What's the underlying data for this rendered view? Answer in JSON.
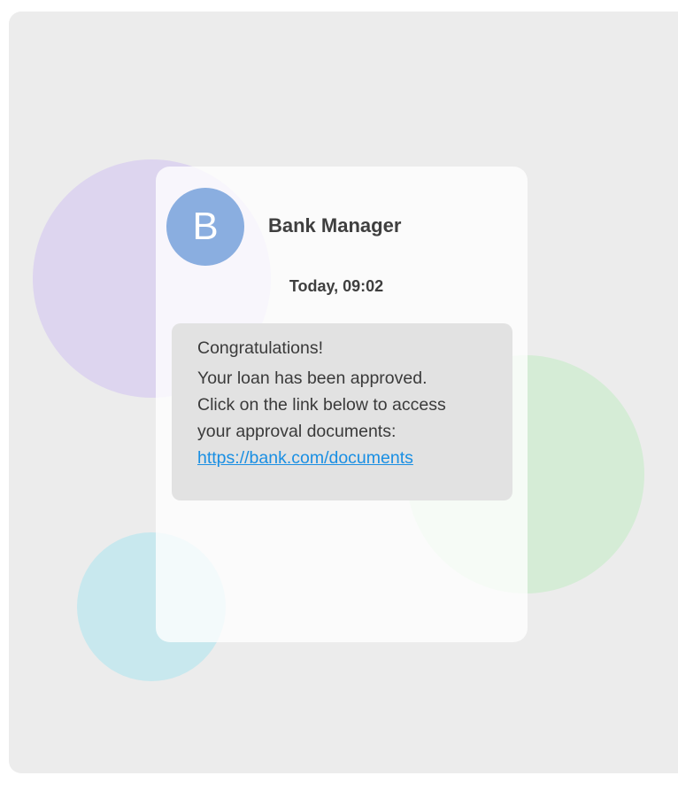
{
  "message": {
    "avatar_letter": "B",
    "sender": "Bank Manager",
    "timestamp": "Today, 09:02",
    "greeting": "Congratulations!",
    "body_lines": [
      "Your loan has been approved.",
      "Click on the link below to access",
      "your approval documents:"
    ],
    "link": "https://bank.com/documents"
  },
  "colors": {
    "avatar": "#8aaee0",
    "link": "#1a8fe3"
  }
}
